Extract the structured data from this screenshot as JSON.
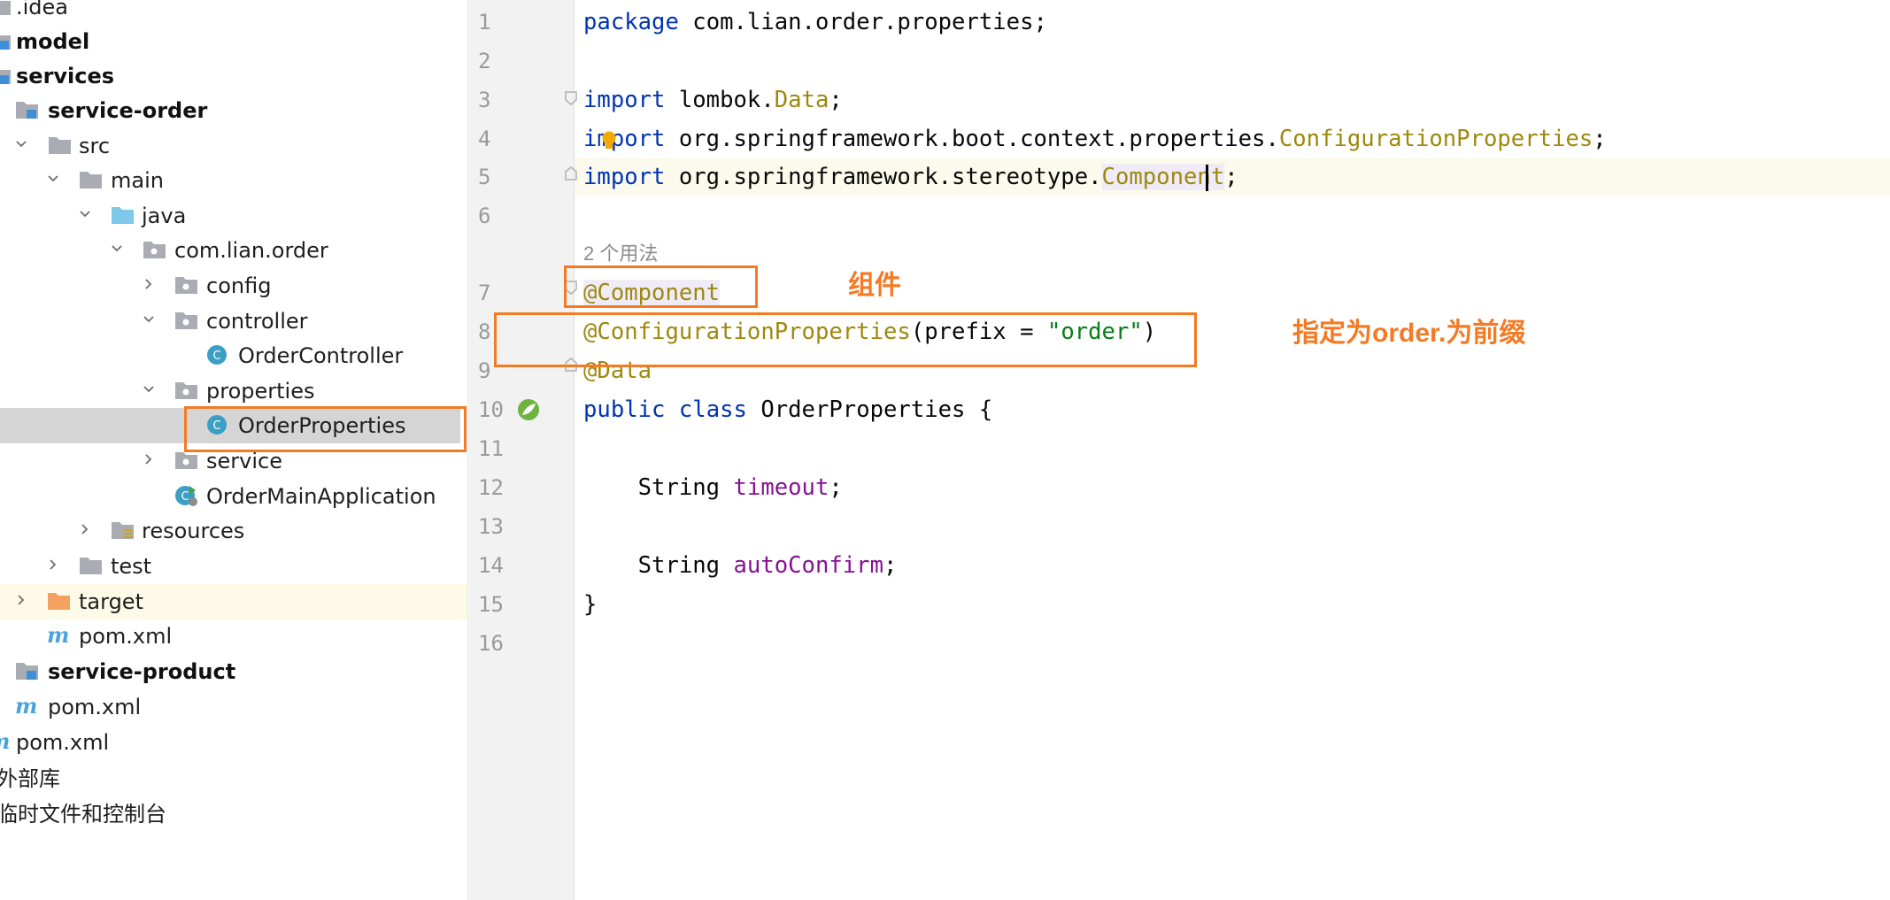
{
  "colors": {
    "annotation": "#f47a24",
    "selection": "#d5d5d5",
    "keyword": "#0033b3",
    "class_ref": "#9e880d",
    "string": "#067d17",
    "field": "#871094"
  },
  "project_tree": {
    "items": [
      {
        "label": ".idea",
        "icon": "folder-icon"
      },
      {
        "label": "model",
        "icon": "module-folder-icon",
        "bold": true
      },
      {
        "label": "services",
        "icon": "module-folder-icon",
        "bold": true
      },
      {
        "label": "service-order",
        "icon": "module-folder-icon",
        "bold": true
      },
      {
        "label": "src",
        "icon": "folder-icon",
        "chevron": "down"
      },
      {
        "label": "main",
        "icon": "folder-icon",
        "chevron": "down"
      },
      {
        "label": "java",
        "icon": "source-folder-icon",
        "chevron": "down"
      },
      {
        "label": "com.lian.order",
        "icon": "package-icon",
        "chevron": "down"
      },
      {
        "label": "config",
        "icon": "package-icon",
        "chevron": "right"
      },
      {
        "label": "controller",
        "icon": "package-icon",
        "chevron": "down"
      },
      {
        "label": "OrderController",
        "icon": "class-icon"
      },
      {
        "label": "properties",
        "icon": "package-icon",
        "chevron": "down"
      },
      {
        "label": "OrderProperties",
        "icon": "class-icon",
        "selected": true
      },
      {
        "label": "service",
        "icon": "package-icon",
        "chevron": "right"
      },
      {
        "label": "OrderMainApplication",
        "icon": "spring-boot-class-icon"
      },
      {
        "label": "resources",
        "icon": "resources-folder-icon",
        "chevron": "right"
      },
      {
        "label": "test",
        "icon": "folder-icon",
        "chevron": "right"
      },
      {
        "label": "target",
        "icon": "excluded-folder-icon",
        "chevron": "right"
      },
      {
        "label": "pom.xml",
        "icon": "maven-icon"
      },
      {
        "label": "service-product",
        "icon": "module-folder-icon",
        "bold": true
      },
      {
        "label": "pom.xml",
        "icon": "maven-icon"
      },
      {
        "label": "pom.xml",
        "icon": "maven-icon"
      },
      {
        "label": "外部库",
        "icon": "none"
      },
      {
        "label": "临时文件和控制台",
        "icon": "none"
      }
    ]
  },
  "editor": {
    "line_numbers": [
      "1",
      "2",
      "3",
      "4",
      "5",
      "6",
      "7",
      "8",
      "9",
      "10",
      "11",
      "12",
      "13",
      "14",
      "15",
      "16"
    ],
    "usage_hint": "2 个用法",
    "lines": {
      "l1_kw": "package",
      "l1_rest": " com.lian.order.properties;",
      "l3_kw": "import",
      "l3_a": " lombok.",
      "l3_cls": "Data",
      "l3_end": ";",
      "l4_kw": "import",
      "l4_a": " org.springframework.boot.context.properties.",
      "l4_cls": "ConfigurationProperties",
      "l4_end": ";",
      "l5_kw": "import",
      "l5_a": " org.springframework.stereotype.",
      "l5_cls": "Component",
      "l5_end": ";",
      "l7_ann": "@Component",
      "l8_ann": "@ConfigurationProperties",
      "l8_a": "(prefix = ",
      "l8_str": "\"order\"",
      "l8_end": ")",
      "l9_ann": "@Data",
      "l10_kw1": "public",
      "l10_kw2": "class",
      "l10_rest": " OrderProperties {",
      "l12_type": "    String ",
      "l12_fld": "timeout",
      "l12_end": ";",
      "l14_type": "    String ",
      "l14_fld": "autoConfirm",
      "l14_end": ";",
      "l15": "}"
    }
  },
  "annotations": {
    "component_note": "组件",
    "prefix_note": "指定为order.为前缀"
  }
}
